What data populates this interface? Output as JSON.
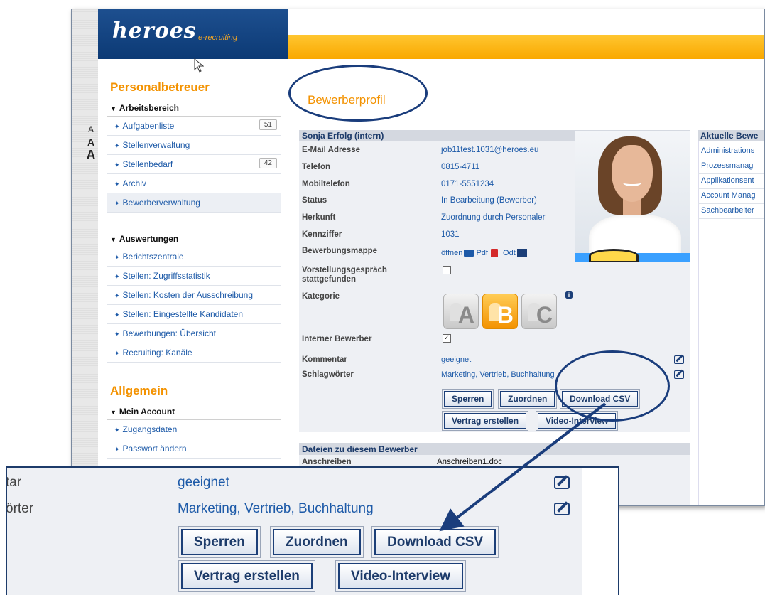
{
  "app": {
    "logo": "heroes",
    "logo_sub": "e-recruiting",
    "font_sizes": [
      "A",
      "A",
      "A"
    ]
  },
  "sidebar": {
    "section1_title": "Personalbetreuer",
    "group1": "Arbeitsbereich",
    "group1_items": [
      {
        "label": "Aufgabenliste",
        "count": "51"
      },
      {
        "label": "Stellenverwaltung",
        "count": ""
      },
      {
        "label": "Stellenbedarf",
        "count": "42"
      },
      {
        "label": "Archiv",
        "count": ""
      },
      {
        "label": "Bewerberverwaltung",
        "count": ""
      }
    ],
    "group2": "Auswertungen",
    "group2_items": [
      {
        "label": "Berichtszentrale"
      },
      {
        "label": "Stellen: Zugriffsstatistik"
      },
      {
        "label": "Stellen: Kosten der Ausschreibung"
      },
      {
        "label": "Stellen: Eingestellte Kandidaten"
      },
      {
        "label": "Bewerbungen: Übersicht"
      },
      {
        "label": "Recruiting: Kanäle"
      }
    ],
    "section2_title": "Allgemein",
    "group3": "Mein Account",
    "group3_items": [
      {
        "label": "Zugangsdaten"
      },
      {
        "label": "Passwort ändern"
      }
    ]
  },
  "profile": {
    "page_title": "Bewerberprofil",
    "name": "Sonja Erfolg (intern)",
    "rows": [
      {
        "label": "E-Mail Adresse",
        "value": "job11test.1031@heroes.eu"
      },
      {
        "label": "Telefon",
        "value": "0815-4711"
      },
      {
        "label": "Mobiltelefon",
        "value": "0171-5551234"
      },
      {
        "label": "Status",
        "value": "In Bearbeitung (Bewerber)"
      },
      {
        "label": "Herkunft",
        "value": "Zuordnung durch Personaler"
      },
      {
        "label": "Kennziffer",
        "value": "1031"
      }
    ],
    "mappe_label": "Bewerbungsmappe",
    "mappe_open": "öffnen",
    "mappe_pdf": "Pdf",
    "mappe_odt": "Odt",
    "interview_label_1": "Vorstellungsgespräch",
    "interview_label_2": "stattgefunden",
    "interview_checked": false,
    "kategorie_label": "Kategorie",
    "kategorie_options": [
      "A",
      "B",
      "C"
    ],
    "kategorie_selected": "B",
    "intern_label": "Interner Bewerber",
    "intern_checked": true,
    "kommentar_label": "Kommentar",
    "kommentar_value": "geeignet",
    "schlag_label": "Schlagwörter",
    "schlag_value": "Marketing, Vertrieb, Buchhaltung",
    "buttons": {
      "sperren": "Sperren",
      "zuordnen": "Zuordnen",
      "download_csv": "Download CSV",
      "vertrag": "Vertrag erstellen",
      "video": "Video-Interview"
    }
  },
  "files": {
    "header": "Dateien zu diesem Bewerber",
    "label": "Anschreiben",
    "value": "Anschreiben1.doc"
  },
  "right": {
    "header": "Aktuelle Bewe",
    "items": [
      "Administrations",
      "Prozessmanag",
      "Applikationsent",
      "Account Manag",
      "Sachbearbeiter"
    ]
  },
  "zoom": {
    "label1": "tar",
    "label2": "örter",
    "value1": "geeignet",
    "value2": "Marketing, Vertrieb, Buchhaltung",
    "sperren": "Sperren",
    "zuordnen": "Zuordnen",
    "download_csv": "Download CSV",
    "vertrag": "Vertrag erstellen",
    "video": "Video-Interview"
  },
  "colors": {
    "brand_blue": "#1c3f78",
    "accent_orange": "#f39200",
    "link_blue": "#1d5aa8"
  }
}
